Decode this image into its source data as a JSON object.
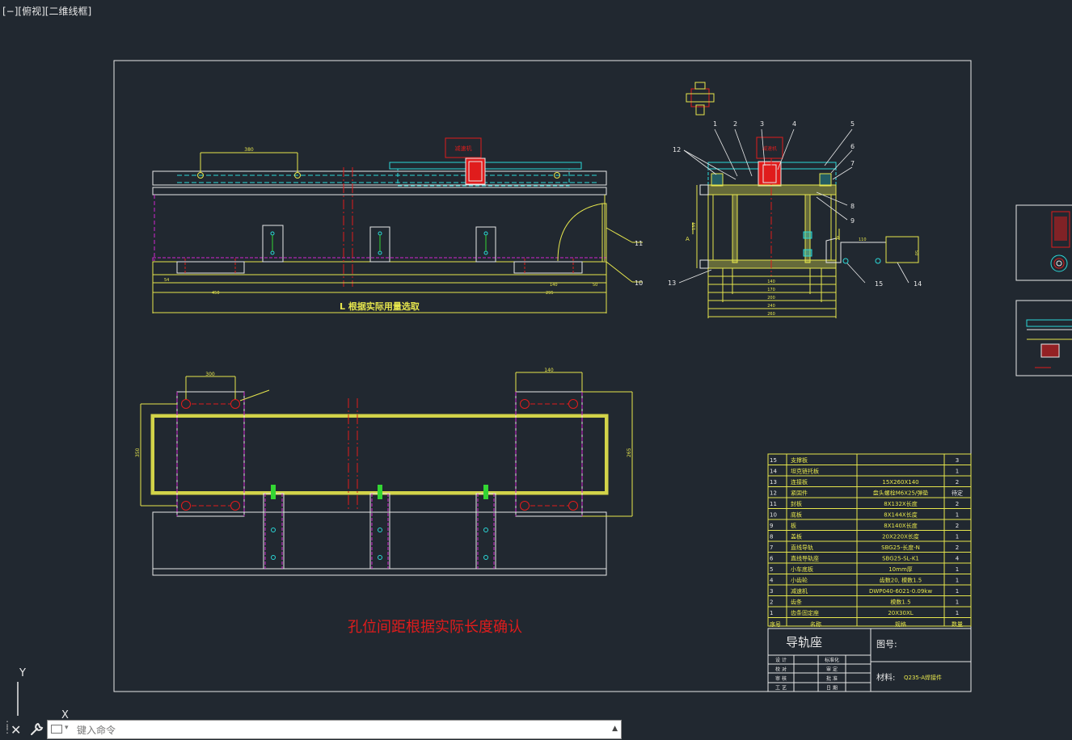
{
  "viewport": {
    "label": "[−][俯视][二维线框]"
  },
  "ucs": {
    "y_axis": "Y",
    "x_axis": "X"
  },
  "command_line": {
    "placeholder": "键入命令"
  },
  "drawing": {
    "note": "孔位间距根据实际长度确认",
    "front_view_note": "L  根据实际用量选取",
    "gearbox_label": "减速机",
    "callouts": [
      "1",
      "2",
      "3",
      "4",
      "5",
      "6",
      "7",
      "8",
      "9",
      "10",
      "11",
      "12",
      "13",
      "14",
      "15"
    ],
    "dims": {
      "top_span": "380",
      "bracket_small": "60",
      "left_end": "54",
      "right_end": "50",
      "mid_span": "140",
      "base_span": "295",
      "total_left": "450",
      "plan_span_left": "300",
      "plan_span_right": "140",
      "plan_height": "350",
      "plan_right_height": "265",
      "section_w1": "140",
      "section_w2": "170",
      "section_w3": "200",
      "section_w4": "240",
      "section_w5": "260",
      "section_side": "110",
      "section_side2": "50",
      "section_h": "135"
    },
    "section_marks": [
      "A",
      "A"
    ]
  },
  "bom": {
    "rows": [
      {
        "no": "15",
        "name": "支撑板",
        "spec": "",
        "qty": "3"
      },
      {
        "no": "14",
        "name": "坦克链托板",
        "spec": "",
        "qty": "1"
      },
      {
        "no": "13",
        "name": "连接板",
        "spec": "15X260X140",
        "qty": "2"
      },
      {
        "no": "12",
        "name": "紧固件",
        "spec": "盘头螺栓M6X25/弹垫",
        "qty": "待定"
      },
      {
        "no": "11",
        "name": "封板",
        "spec": "8X132X长度",
        "qty": "2"
      },
      {
        "no": "10",
        "name": "底板",
        "spec": "8X144X长度",
        "qty": "1"
      },
      {
        "no": "9",
        "name": "板",
        "spec": "8X140X长度",
        "qty": "2"
      },
      {
        "no": "8",
        "name": "盖板",
        "spec": "20X220X长度",
        "qty": "1"
      },
      {
        "no": "7",
        "name": "直线导轨",
        "spec": "SBG25-长度-N",
        "qty": "2"
      },
      {
        "no": "6",
        "name": "直线导轨座",
        "spec": "SBG25-SL-K1",
        "qty": "4"
      },
      {
        "no": "5",
        "name": "小车底板",
        "spec": "10mm厚",
        "qty": "1"
      },
      {
        "no": "4",
        "name": "小齿轮",
        "spec": "齿数20, 模数1.5",
        "qty": "1"
      },
      {
        "no": "3",
        "name": "减速机",
        "spec": "DWP040-6021-0.09kw",
        "qty": "1"
      },
      {
        "no": "2",
        "name": "齿条",
        "spec": "模数1.5",
        "qty": "1"
      },
      {
        "no": "1",
        "name": "齿条固定座",
        "spec": "20X30XL",
        "qty": "1"
      }
    ],
    "header": {
      "no": "序号",
      "name": "名称",
      "spec": "规格",
      "qty": "数量"
    }
  },
  "title_block": {
    "part_name": "导轨座",
    "drawing_no_label": "图号:",
    "material_label": "材料:",
    "material_value": "Q235-A焊接件",
    "roles": [
      {
        "left": "设 计",
        "right": "标准化"
      },
      {
        "left": "校 对",
        "right": "审 定"
      },
      {
        "left": "审 核",
        "right": "批 准"
      },
      {
        "left": "工 艺",
        "right": "日 期"
      }
    ]
  },
  "colors": {
    "background": "#212830",
    "border": "#ffffff",
    "yellow": "#e6e64d",
    "cyan": "#2bd9d9",
    "red": "#e01c1c",
    "magenta": "#d126d1",
    "green": "#33d633",
    "white": "#e8e8e8"
  }
}
